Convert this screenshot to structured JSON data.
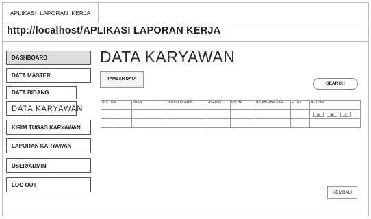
{
  "app": {
    "tab_title": "APLIKASI_LAPORAN_KERJA"
  },
  "address_bar": {
    "url": "http://localhost/APLIKASI LAPORAN KERJA"
  },
  "sidebar": {
    "items": [
      {
        "label": "DASHBOARD"
      },
      {
        "label": "DATA MASTER"
      },
      {
        "label": "DATA BIDANG"
      },
      {
        "label": "DATA KARYAWAN"
      },
      {
        "label": "KIRIM TUGAS KARYAWAN"
      },
      {
        "label": "LAPORAN KARYAWAN"
      },
      {
        "label": "USER/ADMIN"
      },
      {
        "label": "LOG OUT"
      }
    ]
  },
  "main": {
    "title": "DATA KARYAWAN",
    "add_button": "TAMBAH DATA",
    "search_button": "SEARCH",
    "back_button": "KEMBALI",
    "table": {
      "columns": [
        "NO",
        "NIK",
        "NAMA",
        "JENIS KELAMIN",
        "ALAMAT",
        "NO HP",
        "BIDANG/BAGIAN",
        "FOTO",
        "ACTION"
      ],
      "action_icons": [
        "view-icon",
        "edit-icon",
        "delete-icon"
      ]
    }
  },
  "colors": {
    "border": "#bdbdbd",
    "active_nav_bg": "#dcdcdc"
  }
}
